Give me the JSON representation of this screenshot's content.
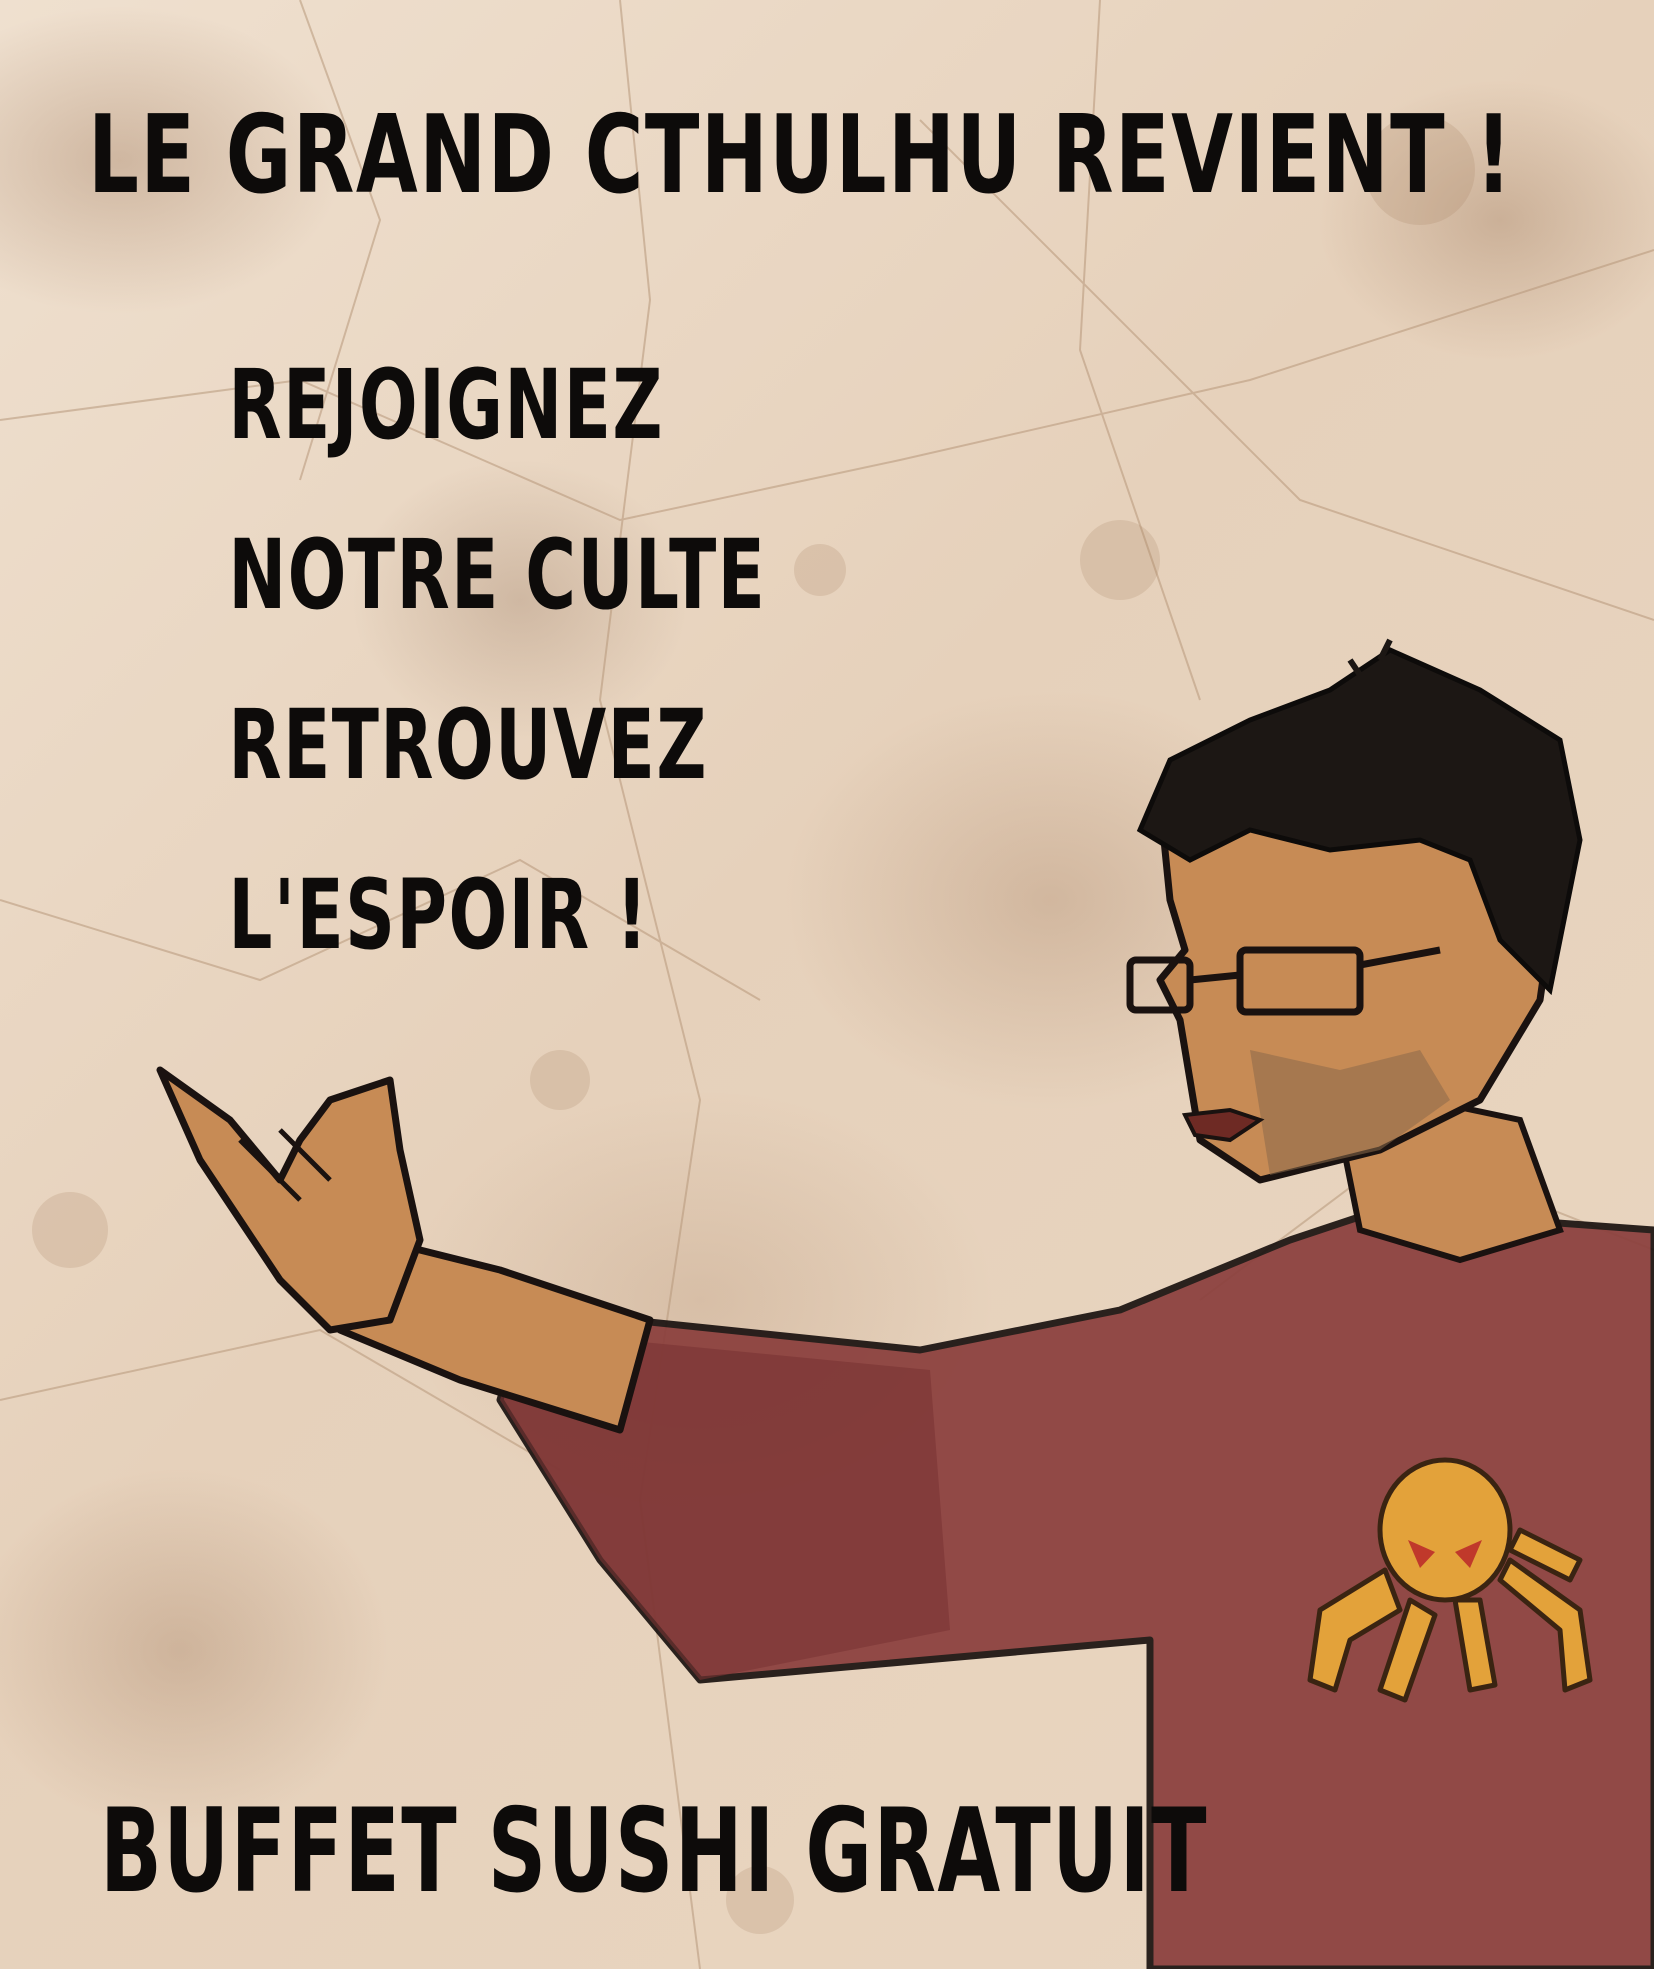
{
  "poster": {
    "title": "LE GRAND CTHULHU REVIENT !",
    "slogan_lines": [
      "REJOIGNEZ",
      "NOTRE CULTE",
      "RETROUVEZ",
      "L'ESPOIR !"
    ],
    "footer": "BUFFET SUSHI GRATUIT"
  },
  "colors": {
    "paper": "#e9d7c3",
    "ink": "#0d0b0a",
    "shirt": "#8a3e3c",
    "skin": "#c78b55",
    "emblem": "#e3a23a"
  }
}
